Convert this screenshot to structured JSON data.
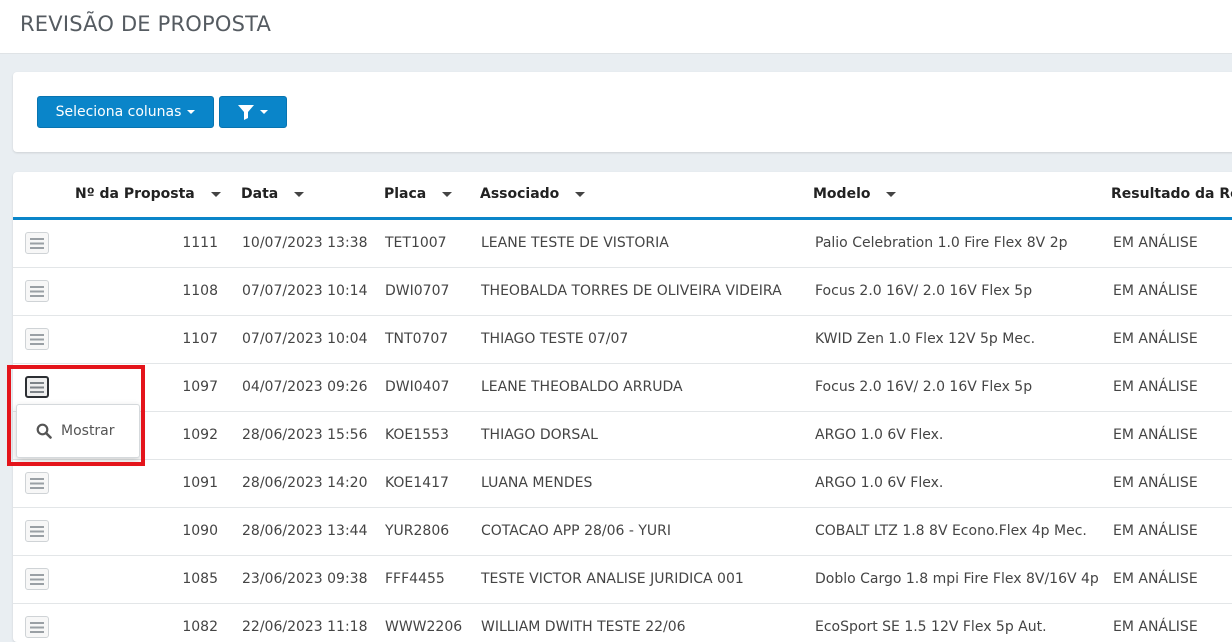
{
  "page": {
    "title": "REVISÃO DE PROPOSTA"
  },
  "toolbar": {
    "columns_button_label": "Seleciona colunas",
    "filter_icon": "filter-icon"
  },
  "table": {
    "headers": {
      "proposal_number": "Nº da Proposta",
      "date": "Data",
      "plate": "Placa",
      "associate": "Associado",
      "model": "Modelo",
      "result": "Resultado da Revisão"
    },
    "rows": [
      {
        "num": "1111",
        "date": "10/07/2023 13:38",
        "plate": "TET1007",
        "associate": "LEANE TESTE DE VISTORIA",
        "model": "Palio Celebration 1.0 Fire Flex 8V 2p",
        "result": "EM ANÁLISE"
      },
      {
        "num": "1108",
        "date": "07/07/2023 10:14",
        "plate": "DWI0707",
        "associate": "THEOBALDA TORRES DE OLIVEIRA VIDEIRA",
        "model": "Focus 2.0 16V/ 2.0 16V Flex 5p",
        "result": "EM ANÁLISE"
      },
      {
        "num": "1107",
        "date": "07/07/2023 10:04",
        "plate": "TNT0707",
        "associate": "THIAGO TESTE 07/07",
        "model": "KWID Zen 1.0 Flex 12V 5p Mec.",
        "result": "EM ANÁLISE"
      },
      {
        "num": "1097",
        "date": "04/07/2023 09:26",
        "plate": "DWI0407",
        "associate": "LEANE THEOBALDO ARRUDA",
        "model": "Focus 2.0 16V/ 2.0 16V Flex 5p",
        "result": "EM ANÁLISE"
      },
      {
        "num": "1092",
        "date": "28/06/2023 15:56",
        "plate": "KOE1553",
        "associate": "THIAGO DORSAL",
        "model": "ARGO 1.0 6V Flex.",
        "result": "EM ANÁLISE"
      },
      {
        "num": "1091",
        "date": "28/06/2023 14:20",
        "plate": "KOE1417",
        "associate": "LUANA MENDES",
        "model": "ARGO 1.0 6V Flex.",
        "result": "EM ANÁLISE"
      },
      {
        "num": "1090",
        "date": "28/06/2023 13:44",
        "plate": "YUR2806",
        "associate": "COTACAO APP 28/06 - YURI",
        "model": "COBALT LTZ 1.8 8V Econo.Flex 4p Mec.",
        "result": "EM ANÁLISE"
      },
      {
        "num": "1085",
        "date": "23/06/2023 09:38",
        "plate": "FFF4455",
        "associate": "TESTE VICTOR ANALISE JURIDICA 001",
        "model": "Doblo Cargo 1.8 mpi Fire Flex 8V/16V 4p",
        "result": "EM ANÁLISE"
      },
      {
        "num": "1082",
        "date": "22/06/2023 11:18",
        "plate": "WWW2206",
        "associate": "WILLIAM DWITH TESTE 22/06",
        "model": "EcoSport SE 1.5 12V Flex 5p Aut.",
        "result": "EM ANÁLISE"
      }
    ]
  },
  "row_menu": {
    "show_label": "Mostrar",
    "show_icon": "search-icon",
    "menu_icon": "hamburger-icon"
  },
  "colors": {
    "primary": "#0a85c9",
    "highlight": "#e4141b"
  }
}
